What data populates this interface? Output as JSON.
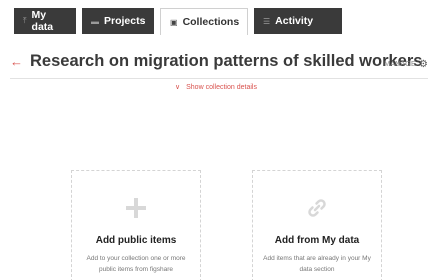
{
  "tabs": [
    {
      "label": "My data",
      "icon": "upload-icon"
    },
    {
      "label": "Projects",
      "icon": "folder-icon"
    },
    {
      "label": "Collections",
      "icon": "collection-icon"
    },
    {
      "label": "Activity",
      "icon": "activity-icon"
    }
  ],
  "active_tab": "Collections",
  "header": {
    "title": "Research on migration patterns of skilled workers",
    "manage_label": "MANAGE",
    "details_toggle": "Show collection details"
  },
  "cards": {
    "public": {
      "title": "Add public items",
      "description": "Add to your collection one or more public items from figshare",
      "icon": "plus-icon"
    },
    "mydata": {
      "title": "Add from My data",
      "description": "Add items that are already in your My data section",
      "icon": "link-icon"
    }
  },
  "colors": {
    "accent": "#d9534f",
    "tab_dark": "#3a3a3a",
    "card_border": "#d4d4d4"
  }
}
